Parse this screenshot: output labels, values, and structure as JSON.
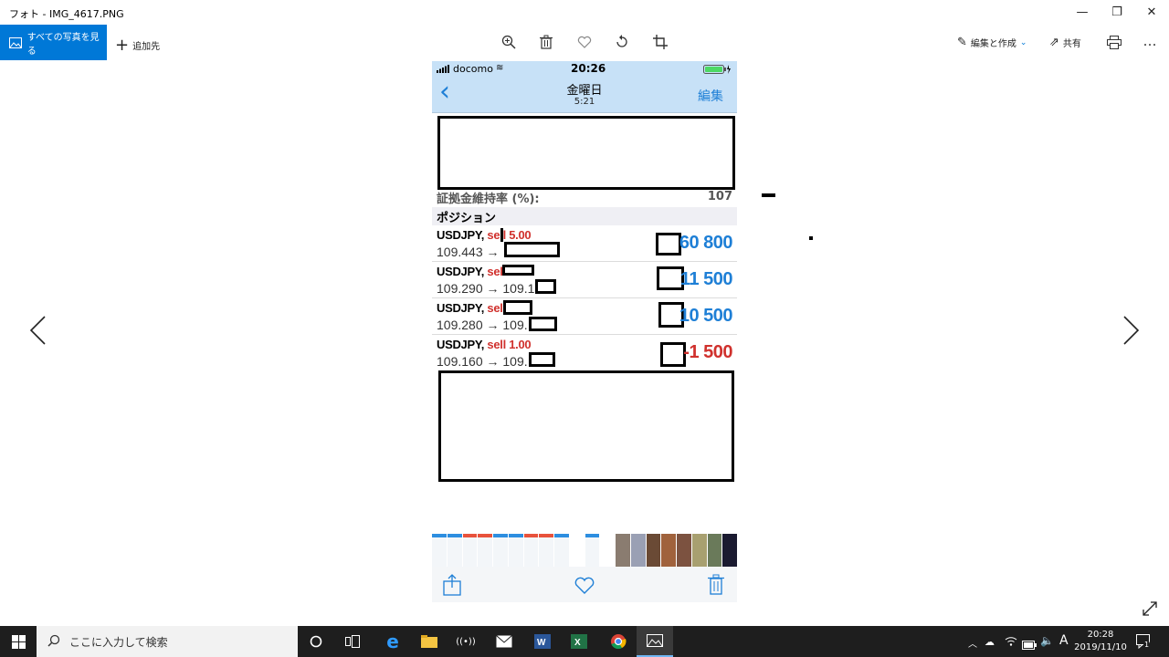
{
  "window": {
    "title": "フォト - IMG_4617.PNG",
    "minimize": "—",
    "maximize": "❐",
    "close": "✕"
  },
  "toolbar": {
    "view_all": "すべての写真を見る",
    "add_to": "追加先",
    "edit_create": "編集と作成",
    "share": "共有",
    "more": "…"
  },
  "phone": {
    "status": {
      "carrier": "docomo",
      "time": "20:26"
    },
    "nav": {
      "back": "‹",
      "title": "金曜日",
      "subtitle": "5:21",
      "edit": "編集"
    },
    "margin_level": {
      "label": "証拠金維持率 (%):",
      "value": "107"
    },
    "positions_header": "ポジション",
    "positions": [
      {
        "symbol": "USDJPY, ",
        "side": "sell ",
        "lots": "5.00",
        "price": "109.443 →",
        "profit": "60 800",
        "color": "blue"
      },
      {
        "symbol": "USDJPY, ",
        "side": "sell",
        "lots": "",
        "price": "109.290 → 109.1",
        "profit": "11 500",
        "color": "blue"
      },
      {
        "symbol": "USDJPY, ",
        "side": "sell",
        "lots": "",
        "price": "109.280 → 109.",
        "profit": "10 500",
        "color": "blue"
      },
      {
        "symbol": "USDJPY, ",
        "side": "sell ",
        "lots": "1.00",
        "price": "109.160 → 109.",
        "profit": "-1 500",
        "color": "red"
      }
    ]
  },
  "taskbar": {
    "search_placeholder": "ここに入力して検索",
    "time": "20:28",
    "date": "2019/11/10",
    "ime": "A",
    "notification_count": "1"
  },
  "colors": {
    "accent": "#0078d7",
    "profit_blue": "#1e7fd6",
    "loss_red": "#d0312d",
    "nav_bg": "#c7e1f7"
  }
}
